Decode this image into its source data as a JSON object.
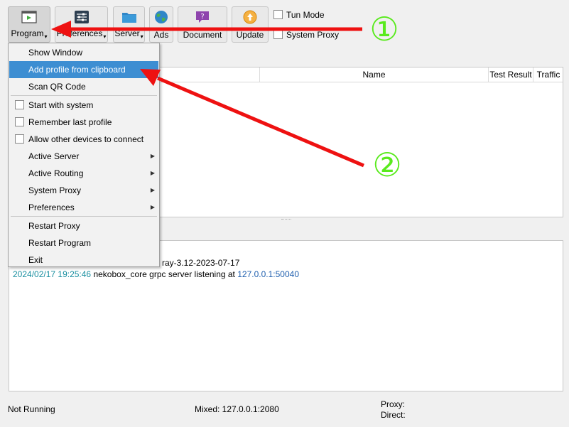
{
  "toolbar": {
    "program": "Program",
    "preferences": "Preferences",
    "server": "Server",
    "ads": "Ads",
    "document": "Document",
    "update": "Update",
    "tun_mode": "Tun Mode",
    "system_proxy": "System Proxy"
  },
  "menu": {
    "items": [
      "Show Window",
      "Add profile from clipboard",
      "Scan QR Code",
      "Start with system",
      "Remember last profile",
      "Allow other devices to connect",
      "Active Server",
      "Active Routing",
      "System Proxy",
      "Preferences",
      "Restart Proxy",
      "Restart Program",
      "Exit"
    ]
  },
  "table": {
    "columns": [
      "Name",
      "Test Result",
      "Traffic"
    ]
  },
  "log": {
    "line1_visible": "ray-3.12-2023-07-17",
    "line2_time": "2024/02/17 19:25:46",
    "line2_text": "nekobox_core grpc server listening at",
    "line2_addr": "127.0.0.1:50040"
  },
  "status": {
    "running": "Not Running",
    "mixed": "Mixed: 127.0.0.1:2080",
    "proxy": "Proxy:",
    "direct": "Direct:"
  },
  "annotations": {
    "step1": "①",
    "step2": "②",
    "circle_color": "#59ea1d",
    "arrow_color": "#ee1111"
  },
  "colors": {
    "menu_highlight": "#3d8ed2",
    "log_time": "#1a8fa0",
    "log_addr": "#1f5fae"
  }
}
